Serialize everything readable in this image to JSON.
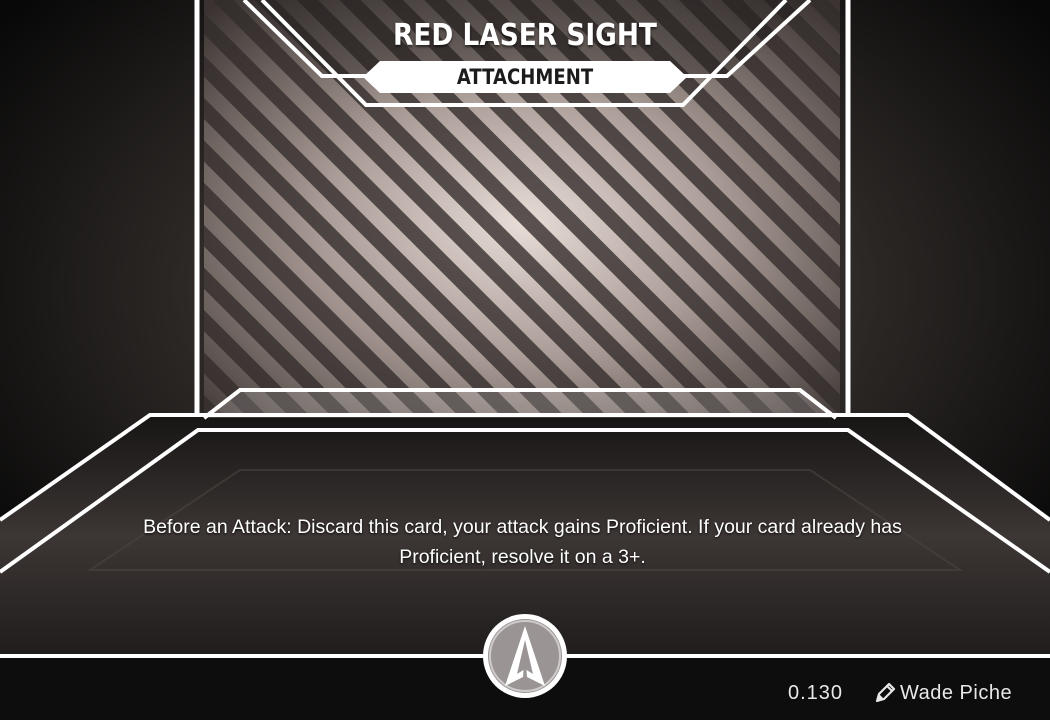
{
  "card": {
    "title": "RED LASER SIGHT",
    "type": "ATTACHMENT",
    "rules_text": "Before an Attack: Discard this card, your attack gains Proficient. If your card already has Proficient, resolve it on a 3+.",
    "number": "0.130",
    "artist": "Wade Piche"
  },
  "icons": {
    "faction": "arrowhead-faction-icon",
    "artist": "pencil-icon"
  },
  "colors": {
    "frame": "#ffffff",
    "background": "#0c0c0c",
    "art_panel": "#b9aeaa"
  }
}
